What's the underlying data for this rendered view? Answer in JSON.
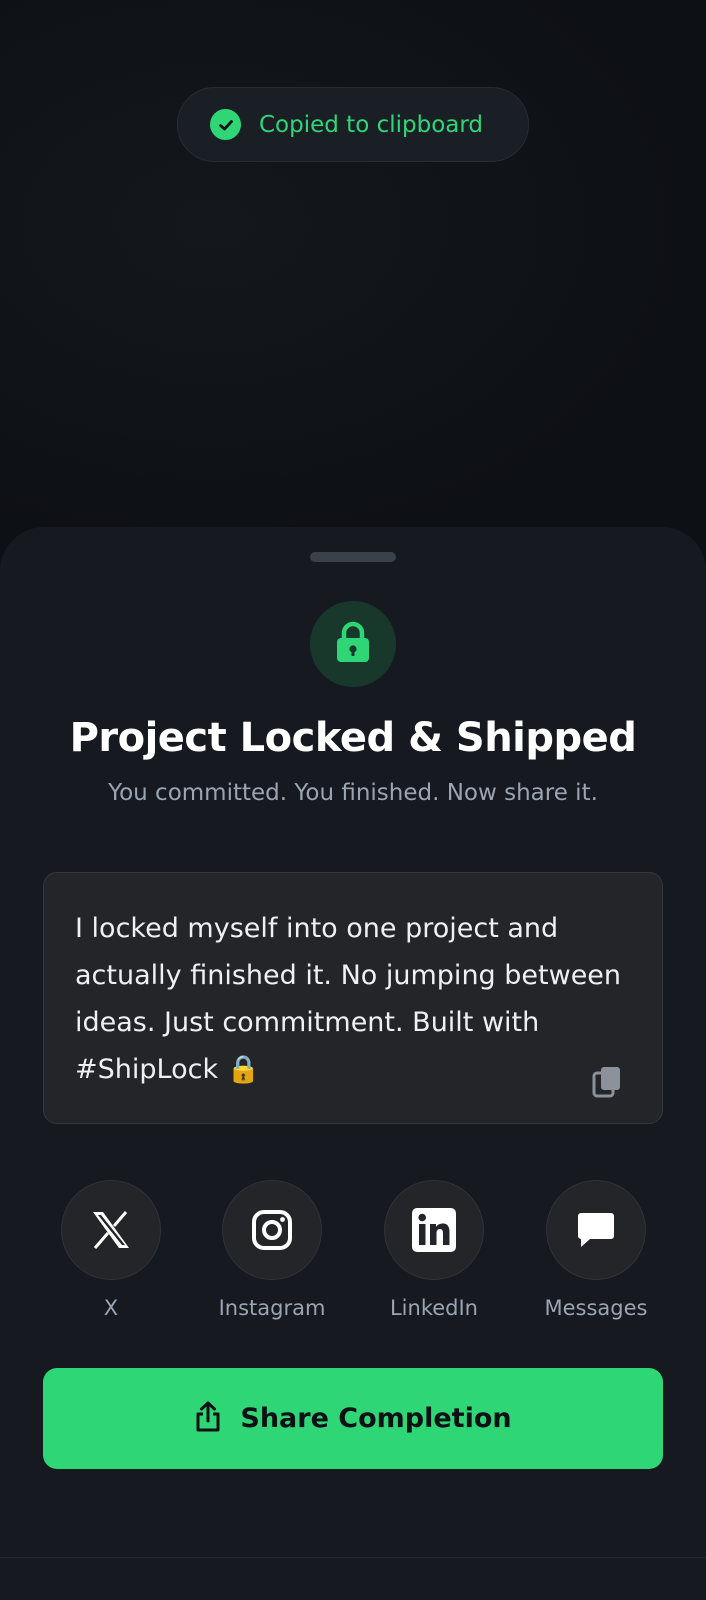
{
  "toast": {
    "text": "Copied to clipboard",
    "icon": "check-circle-icon",
    "color": "#2fd676"
  },
  "sheet": {
    "icon": "lock-icon",
    "title": "Project Locked & Shipped",
    "subtitle": "You committed. You finished. Now share it.",
    "message": "I locked myself into one project and actually finished it. No jumping between ideas. Just commitment. Built with #ShipLock 🔒",
    "copy_icon": "copy-icon"
  },
  "share_targets": [
    {
      "label": "X",
      "icon": "x-logo-icon"
    },
    {
      "label": "Instagram",
      "icon": "instagram-icon"
    },
    {
      "label": "LinkedIn",
      "icon": "linkedin-icon"
    },
    {
      "label": "Messages",
      "icon": "message-bubble-icon"
    }
  ],
  "cta": {
    "label": "Share Completion",
    "icon": "share-icon"
  },
  "colors": {
    "accent": "#2fd676",
    "background": "#0d1014",
    "sheet": "#161a20"
  }
}
